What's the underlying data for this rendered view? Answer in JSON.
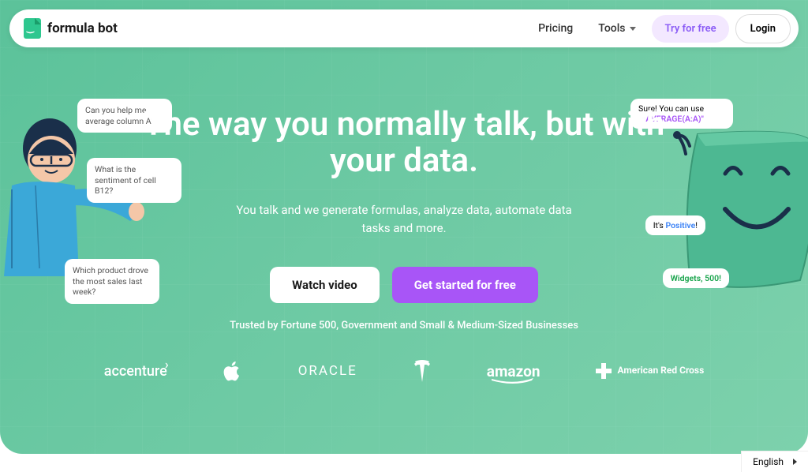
{
  "brand": "formula bot",
  "nav": {
    "pricing": "Pricing",
    "tools": "Tools",
    "tryFree": "Try for free",
    "login": "Login"
  },
  "hero": {
    "title": "The way you normally talk, but with your data.",
    "subtitle": "You talk and we generate formulas, analyze data, automate data tasks and more.",
    "watchVideo": "Watch video",
    "getStarted": "Get started for free"
  },
  "trusted": "Trusted by Fortune 500, Government and Small & Medium-Sized Businesses",
  "companies": {
    "accenture": "accenture",
    "oracle": "ORACLE",
    "amazon": "amazon",
    "redcross": "American Red Cross"
  },
  "userBubbles": {
    "b1": "Can you help me average column A?",
    "b2": "What is the sentiment of cell B12?",
    "b3": "Which product drove the most sales last week?"
  },
  "botBubbles": {
    "b1_prefix": "Sure! You can use ",
    "b1_formula": "\"=AVERAGE(A:A)\"",
    "b2_prefix": "It's ",
    "b2_value": "Positive",
    "b2_suffix": "!",
    "b3": "Widgets, 500!"
  },
  "language": "English"
}
